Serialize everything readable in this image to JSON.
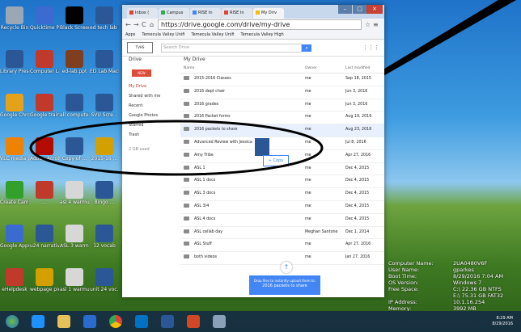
{
  "desktop_icons": [
    {
      "label": "Recycle Bin",
      "color": "#9aa7b4"
    },
    {
      "label": "Quicktime Player",
      "color": "#3b6ad1"
    },
    {
      "label": "Black Screen",
      "color": "#000000"
    },
    {
      "label": "ed tech lab info.doc",
      "color": "#2b5797"
    },
    {
      "label": "Library Presentations",
      "color": "#2b5797"
    },
    {
      "label": "Computer Lab",
      "color": "#c0392b"
    },
    {
      "label": "ed-lab.ppt",
      "color": "#7f3f1f"
    },
    {
      "label": "ED Lab Mach Videos",
      "color": "#2b5797"
    },
    {
      "label": "Google Chrome",
      "color": "#e3a21a"
    },
    {
      "label": "Google training",
      "color": "#c0392b"
    },
    {
      "label": "all computers",
      "color": "#2b5797"
    },
    {
      "label": "SVU Scre...",
      "color": "#2b5797"
    },
    {
      "label": "VLC media player",
      "color": "#ef8200"
    },
    {
      "label": "Adobe Acrobat DC",
      "color": "#b30b00"
    },
    {
      "label": "Copy of ...",
      "color": "#2b5797"
    },
    {
      "label": "2015-16 ...",
      "color": "#d4a000"
    },
    {
      "label": "Create Campus",
      "color": "#33a02c"
    },
    {
      "label": "...",
      "color": "#c0392b"
    },
    {
      "label": "asl 4 warmups",
      "color": "#d7d7d7"
    },
    {
      "label": "Bingo ...",
      "color": "#2b5797"
    },
    {
      "label": "Google Apps",
      "color": "#3b6ad1"
    },
    {
      "label": "u24 narrative",
      "color": "#2b5797"
    },
    {
      "label": "ASL 3 warmups",
      "color": "#d7d7d7"
    },
    {
      "label": "12 vocab",
      "color": "#2b5797"
    },
    {
      "label": "eHelpdesk",
      "color": "#c0392b"
    },
    {
      "label": "webpage pics",
      "color": "#d4a000"
    },
    {
      "label": "asl 1 warmups",
      "color": "#d7d7d7"
    },
    {
      "label": "unit 24 voc...",
      "color": "#2b5797"
    }
  ],
  "system_info": [
    {
      "k": "Computer Name:",
      "v": "2UA0480V6F"
    },
    {
      "k": "User Name:",
      "v": "gparkes"
    },
    {
      "k": "Boot Time:",
      "v": "8/29/2016 7:04 AM"
    },
    {
      "k": "OS Version:",
      "v": "Windows 7"
    },
    {
      "k": "Free Space:",
      "v": "C:\\ 22.36 GB NTFS"
    },
    {
      "k": "",
      "v": "E:\\ 75.31 GB FAT32"
    },
    {
      "k": "IP Address:",
      "v": "10.1.16.254"
    },
    {
      "k": "Memory:",
      "v": "3992 MB"
    }
  ],
  "browser": {
    "tabs": [
      {
        "label": "Inbox (",
        "color": "#db4437"
      },
      {
        "label": "Campus",
        "color": "#34a853"
      },
      {
        "label": "RISE In",
        "color": "#4285f4"
      },
      {
        "label": "RISE In",
        "color": "#db4437"
      },
      {
        "label": "My Driv",
        "color": "#fbbc05"
      }
    ],
    "url": "https://drive.google.com/drive/my-drive",
    "bookmarks": [
      "Apps",
      "Temecula Valley Unifi",
      "Temecula Valley Unifi",
      "Temecula Valley High"
    ]
  },
  "drive": {
    "logo_text": "TVHS",
    "search_placeholder": "Search Drive",
    "title": "My Drive",
    "new_button": "NEW",
    "nav": [
      "Drive",
      "My Drive",
      "Shared with me",
      "Recent",
      "Google Photos",
      "Starred",
      "Trash"
    ],
    "storage": "2 GB used",
    "col_name": "Name",
    "col_owner": "Owner",
    "col_modified": "Last modified",
    "files": [
      {
        "name": "2015-2016 Classes",
        "owner": "me",
        "date": "Sep 18, 2015"
      },
      {
        "name": "2016 dept chair",
        "owner": "me",
        "date": "Jun 3, 2016"
      },
      {
        "name": "2016 grades",
        "owner": "me",
        "date": "Jun 3, 2016"
      },
      {
        "name": "2016 Packet forms",
        "owner": "me",
        "date": "Aug 19, 2016"
      },
      {
        "name": "2016 packets to share",
        "owner": "me",
        "date": "Aug 23, 2016"
      },
      {
        "name": "Advanced Review with Jessica",
        "owner": "me",
        "date": "Jul 8, 2016"
      },
      {
        "name": "Amy Tribe",
        "owner": "me",
        "date": "Apr 27, 2016"
      },
      {
        "name": "ASL 1",
        "owner": "me",
        "date": "Dec 4, 2015"
      },
      {
        "name": "ASL 1 docs",
        "owner": "me",
        "date": "Dec 4, 2015"
      },
      {
        "name": "ASL 3 docs",
        "owner": "me",
        "date": "Dec 4, 2015"
      },
      {
        "name": "ASL 3/4",
        "owner": "me",
        "date": "Dec 4, 2015"
      },
      {
        "name": "ASL 4 docs",
        "owner": "me",
        "date": "Dec 4, 2015"
      },
      {
        "name": "ASL cellab day",
        "owner": "Meghan Santone",
        "date": "Dec 1, 2014"
      },
      {
        "name": "ASL Stuff",
        "owner": "me",
        "date": "Apr 27, 2016"
      },
      {
        "name": "both videos",
        "owner": "me",
        "date": "Jan 27, 2016"
      }
    ],
    "copy_label": "+ Copy",
    "upload_line1": "Drop files to instantly upload them to:",
    "upload_line2": "2016 packets to share"
  },
  "tray": {
    "time": "8:29 AM",
    "date": "8/29/2016"
  },
  "taskbar_apps": [
    "start",
    "ie",
    "explorer",
    "media",
    "chrome",
    "outlook",
    "word",
    "powerpoint",
    "tool"
  ]
}
